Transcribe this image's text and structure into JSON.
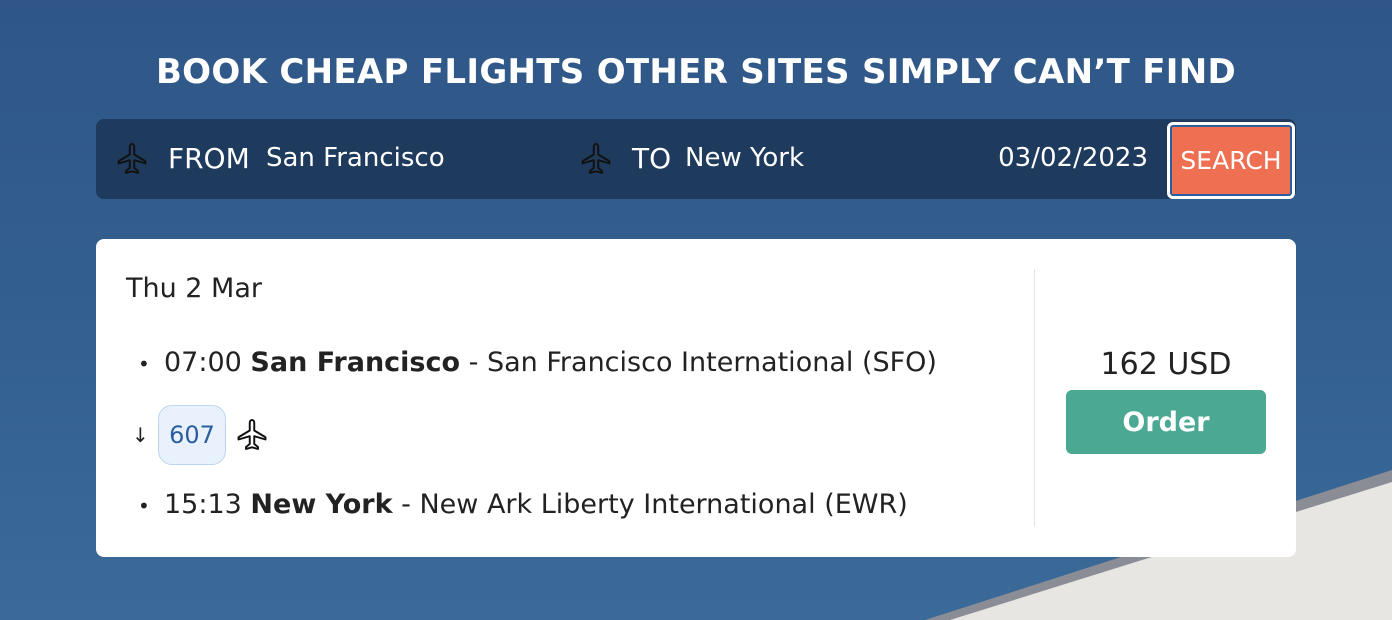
{
  "hero": {
    "headline": "BOOK CHEAP FLIGHTS OTHER SITES SIMPLY CAN’T FIND"
  },
  "search": {
    "from_label": "FROM",
    "from_value": "San Francisco",
    "to_label": "TO",
    "to_value": "New York",
    "date_value": "03/02/2023",
    "search_label": "SEARCH"
  },
  "result": {
    "date": "Thu 2 Mar",
    "departure": {
      "time": "07:00",
      "city": "San Francisco",
      "airport": "- San Francisco International (SFO)"
    },
    "flight_number": "607",
    "arrival": {
      "time": "15:13",
      "city": "New York",
      "airport": "- New Ark Liberty International (EWR)"
    },
    "price": "162 USD",
    "order_label": "Order"
  },
  "icons": [
    "airplane-icon",
    "arrow-down-icon"
  ],
  "colors": {
    "background": "#315a8b",
    "search_bar": "#1e3a5c",
    "search_button": "#ef6f52",
    "order_button": "#4ba892",
    "badge_text": "#2a5ea0"
  }
}
